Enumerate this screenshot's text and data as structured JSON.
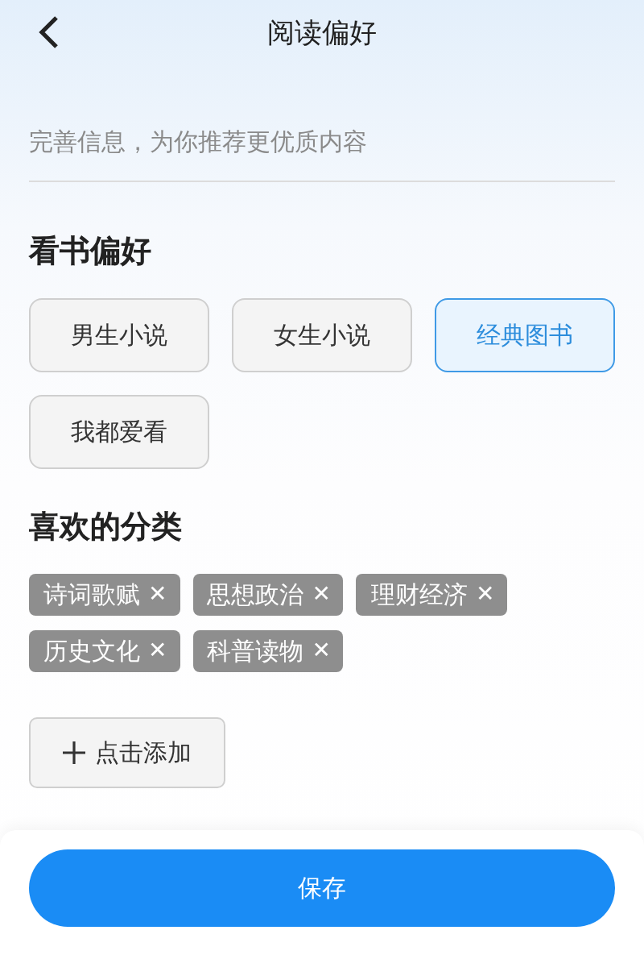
{
  "header": {
    "title": "阅读偏好"
  },
  "subtitle": "完善信息，为你推荐更优质内容",
  "reading_preference": {
    "title": "看书偏好",
    "options": [
      {
        "label": "男生小说",
        "selected": false
      },
      {
        "label": "女生小说",
        "selected": false
      },
      {
        "label": "经典图书",
        "selected": true
      },
      {
        "label": "我都爱看",
        "selected": false
      }
    ]
  },
  "favorite_categories": {
    "title": "喜欢的分类",
    "tags": [
      {
        "label": "诗词歌赋",
        "remove": "✕"
      },
      {
        "label": "思想政治",
        "remove": "✕"
      },
      {
        "label": "理财经济",
        "remove": "✕"
      },
      {
        "label": "历史文化",
        "remove": "✕"
      },
      {
        "label": "科普读物",
        "remove": "✕"
      }
    ],
    "add_button": "点击添加"
  },
  "save_button": "保存"
}
